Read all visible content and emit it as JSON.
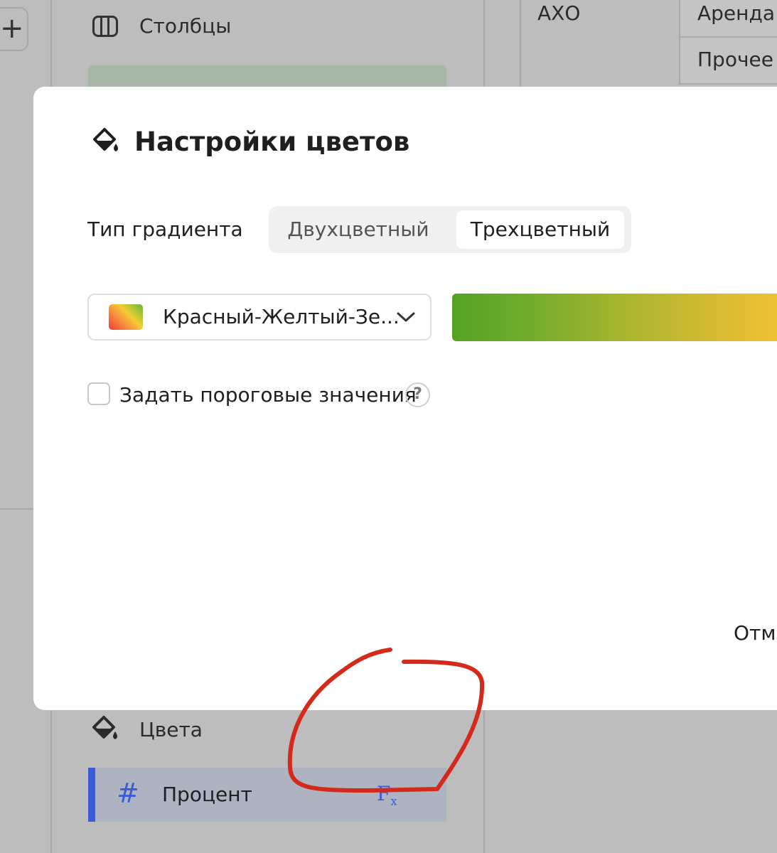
{
  "background": {
    "add_button_label": "+",
    "columns_section": {
      "label": "Столбцы",
      "icon": "columns-icon"
    },
    "table_cells": [
      "АХО",
      "Аренда",
      "Прочее"
    ],
    "colors_section": {
      "label": "Цвета",
      "icon": "paint-bucket-icon"
    },
    "color_field": {
      "name": "Процент",
      "type_icon": "hash-icon",
      "formula_icon": "fx-icon",
      "accent_color": "#3b5bd4"
    }
  },
  "modal": {
    "title": "Настройки цветов",
    "title_icon": "paint-bucket-icon",
    "gradient_type": {
      "label": "Тип градиента",
      "options": [
        "Двухцветный",
        "Трехцветный"
      ],
      "selected": "Трехцветный"
    },
    "palette": {
      "selected": "Красный-Желтый-Зе...",
      "preview_colors": [
        "#54a325",
        "#a9b52f",
        "#fcc334"
      ]
    },
    "thresholds": {
      "label": "Задать пороговые значения",
      "checked": false,
      "help_label": "?"
    },
    "cancel_label": "Отм"
  },
  "annotation": {
    "color": "#d42a1c"
  }
}
